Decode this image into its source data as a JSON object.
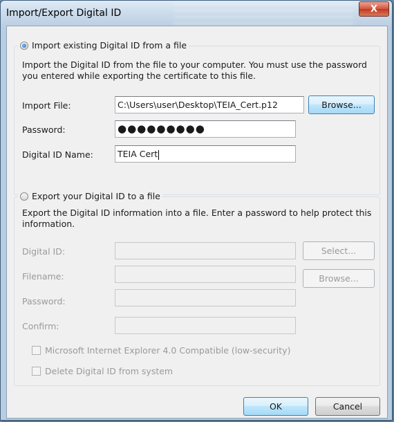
{
  "window": {
    "title": "Import/Export Digital ID",
    "close_label": "X"
  },
  "import": {
    "header": "Import existing Digital ID from a file",
    "description": "Import the Digital ID from the file to your computer. You must use the password you entered while exporting the certificate to this file.",
    "file_label": "Import File:",
    "file_value": "C:\\Users\\user\\Desktop\\TEIA_Cert.p12",
    "browse_label": "Browse...",
    "password_label": "Password:",
    "password_value": "●●●●●●●●●",
    "name_label": "Digital ID Name:",
    "name_value": "TEIA Cert"
  },
  "export": {
    "header": "Export your Digital ID to a file",
    "description": "Export the Digital ID information into a file. Enter a password to help protect this information.",
    "digital_id_label": "Digital ID:",
    "select_label": "Select...",
    "filename_label": "Filename:",
    "browse_label": "Browse...",
    "password_label": "Password:",
    "confirm_label": "Confirm:",
    "ie_compat_label": "Microsoft Internet Explorer 4.0 Compatible (low-security)",
    "delete_label": "Delete Digital ID from system"
  },
  "footer": {
    "ok_label": "OK",
    "cancel_label": "Cancel"
  }
}
